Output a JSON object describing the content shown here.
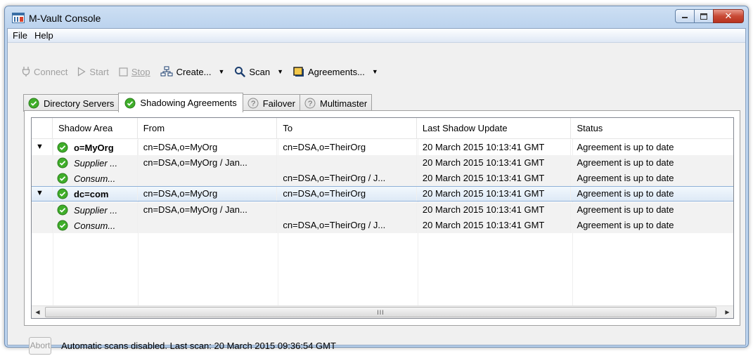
{
  "window": {
    "title": "M-Vault Console"
  },
  "menu": [
    "File",
    "Help"
  ],
  "toolbar": {
    "connect": "Connect",
    "start": "Start",
    "stop": "Stop",
    "create": "Create...",
    "scan": "Scan",
    "agreements": "Agreements..."
  },
  "tabs": [
    {
      "label": "Directory Servers",
      "icon": "check-icon"
    },
    {
      "label": "Shadowing Agreements",
      "icon": "check-icon",
      "active": true
    },
    {
      "label": "Failover",
      "icon": "help-icon"
    },
    {
      "label": "Multimaster",
      "icon": "help-icon"
    }
  ],
  "table": {
    "columns": [
      "Shadow Area",
      "From",
      "To",
      "Last Shadow Update",
      "Status"
    ],
    "rows": [
      {
        "expand": "▼",
        "area": "o=MyOrg",
        "from": "cn=DSA,o=MyOrg",
        "to": "cn=DSA,o=TheirOrg",
        "update": "20 March 2015 10:13:41 GMT",
        "status": "Agreement is up to date"
      },
      {
        "expand": "",
        "area": "Supplier ...",
        "from": "cn=DSA,o=MyOrg / Jan...",
        "to": "",
        "update": "20 March 2015 10:13:41 GMT",
        "status": "Agreement is up to date"
      },
      {
        "expand": "",
        "area": "Consum...",
        "from": "",
        "to": "cn=DSA,o=TheirOrg / J...",
        "update": "20 March 2015 10:13:41 GMT",
        "status": "Agreement is up to date"
      },
      {
        "expand": "▼",
        "area": "dc=com",
        "from": "cn=DSA,o=MyOrg",
        "to": "cn=DSA,o=TheirOrg",
        "update": "20 March 2015 10:13:41 GMT",
        "status": "Agreement is up to date"
      },
      {
        "expand": "",
        "area": "Supplier ...",
        "from": "cn=DSA,o=MyOrg / Jan...",
        "to": "",
        "update": "20 March 2015 10:13:41 GMT",
        "status": "Agreement is up to date"
      },
      {
        "expand": "",
        "area": "Consum...",
        "from": "",
        "to": "cn=DSA,o=TheirOrg / J...",
        "update": "20 March 2015 10:13:41 GMT",
        "status": "Agreement is up to date"
      }
    ],
    "scroll_thumb": "III"
  },
  "status": {
    "abort": "Abort",
    "text": "Automatic scans disabled. Last scan: 20 March 2015 09:36:54 GMT"
  },
  "colors": {
    "check_green": "#3fae2a",
    "selection": "#dde9f6",
    "title_bar": "#bcd3ee"
  }
}
